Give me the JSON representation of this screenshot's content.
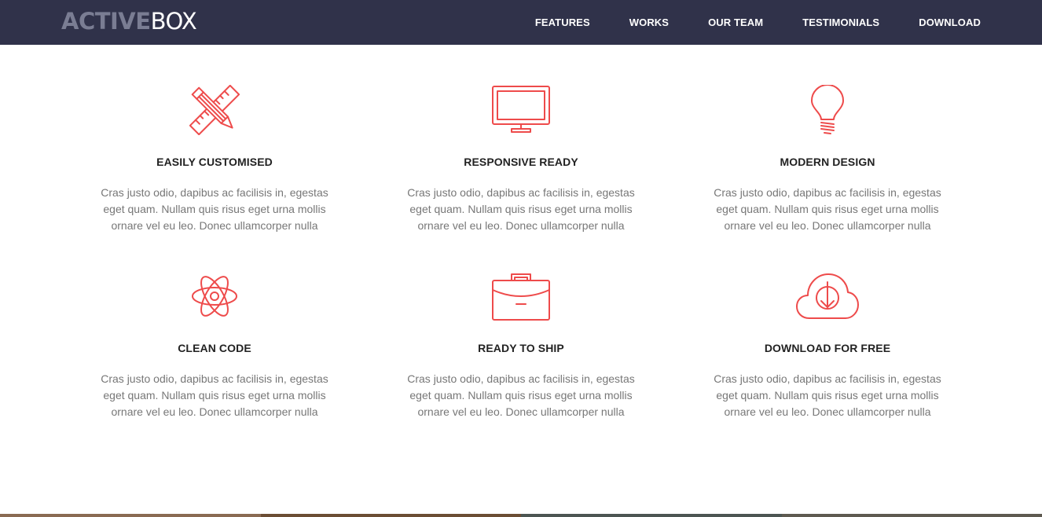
{
  "logo": {
    "bold": "ACTIVE",
    "light": "BOX"
  },
  "nav": {
    "items": [
      "FEATURES",
      "WORKS",
      "OUR TEAM",
      "TESTIMONIALS",
      "DOWNLOAD"
    ]
  },
  "features": [
    {
      "icon": "pencil-ruler-icon",
      "title": "EASILY CUSTOMISED",
      "text": "Cras justo odio, dapibus ac facilisis in, egestas eget quam. Nullam quis risus eget urna mollis ornare vel eu leo. Donec ullamcorper nulla"
    },
    {
      "icon": "monitor-icon",
      "title": "RESPONSIVE READY",
      "text": "Cras justo odio, dapibus ac facilisis in, egestas eget quam. Nullam quis risus eget urna mollis ornare vel eu leo. Donec ullamcorper nulla"
    },
    {
      "icon": "lightbulb-icon",
      "title": "MODERN DESIGN",
      "text": "Cras justo odio, dapibus ac facilisis in, egestas eget quam. Nullam quis risus eget urna mollis ornare vel eu leo. Donec ullamcorper nulla"
    },
    {
      "icon": "atom-icon",
      "title": "CLEAN CODE",
      "text": "Cras justo odio, dapibus ac facilisis in, egestas eget quam. Nullam quis risus eget urna mollis ornare vel eu leo. Donec ullamcorper nulla"
    },
    {
      "icon": "briefcase-icon",
      "title": "READY TO SHIP",
      "text": "Cras justo odio, dapibus ac facilisis in, egestas eget quam. Nullam quis risus eget urna mollis ornare vel eu leo. Donec ullamcorper nulla"
    },
    {
      "icon": "cloud-download-icon",
      "title": "DOWNLOAD FOR FREE",
      "text": "Cras justo odio, dapibus ac facilisis in, egestas eget quam. Nullam quis risus eget urna mollis ornare vel eu leo. Donec ullamcorper nulla"
    }
  ],
  "colors": {
    "navbar": "#30324a",
    "accent": "#ee4b4b",
    "logo_bold": "#7a7d93",
    "heading": "#222222",
    "body_text": "#777777"
  }
}
